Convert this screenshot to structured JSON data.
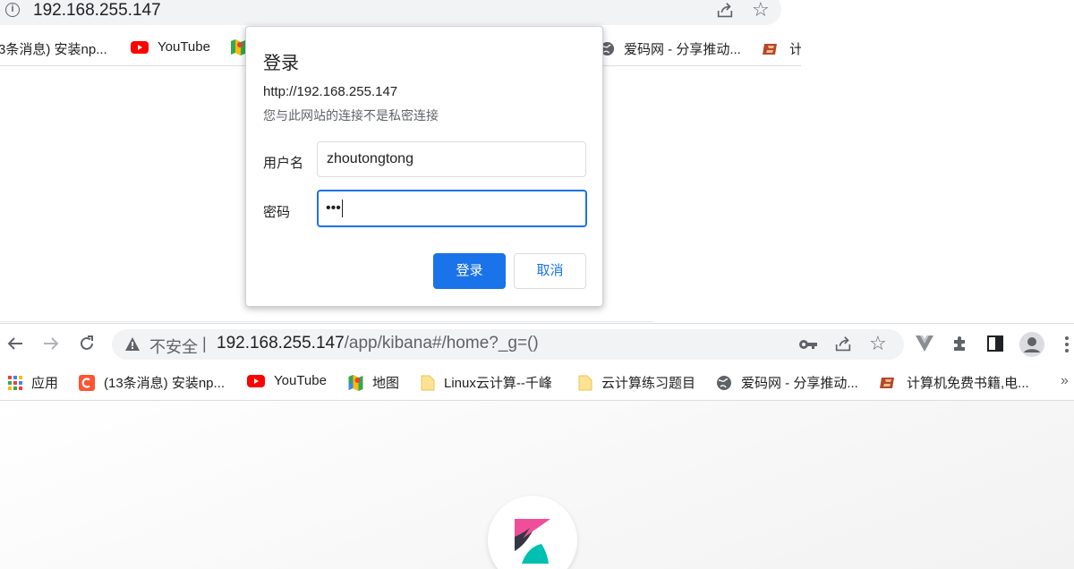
{
  "top_window": {
    "url": "192.168.255.147",
    "bookmarks": [
      {
        "label": "3条消息) 安装np...",
        "icon": "csdn-icon"
      },
      {
        "label": "YouTube",
        "icon": "youtube-icon"
      },
      {
        "label": "爱码网 - 分享推动...",
        "icon": "globe-icon"
      },
      {
        "label": "计",
        "icon": "book-icon"
      }
    ]
  },
  "dialog": {
    "title": "登录",
    "url": "http://192.168.255.147",
    "warning": "您与此网站的连接不是私密连接",
    "username_label": "用户名",
    "username_value": "zhoutongtong",
    "password_label": "密码",
    "password_value": "•••",
    "login_label": "登录",
    "cancel_label": "取消"
  },
  "browser": {
    "not_secure": "不安全",
    "separator": "|",
    "url_host": "192.168.255.147",
    "url_path": "/app/kibana#/home?_g=()",
    "bookmarks": [
      {
        "label": "应用",
        "icon": "apps-grid-icon"
      },
      {
        "label": "(13条消息) 安装np...",
        "icon": "csdn-icon"
      },
      {
        "label": "YouTube",
        "icon": "youtube-icon"
      },
      {
        "label": "地图",
        "icon": "maps-icon"
      },
      {
        "label": "Linux云计算--千峰",
        "icon": "folder-icon"
      },
      {
        "label": "云计算练习题目",
        "icon": "folder-icon"
      },
      {
        "label": "爱码网 - 分享推动...",
        "icon": "globe-icon"
      },
      {
        "label": "计算机免费书籍,电...",
        "icon": "book-icon"
      }
    ],
    "overflow": "»"
  },
  "colors": {
    "accent": "#1a73e8",
    "kibana_pink": "#f04e98",
    "kibana_teal": "#00bfb3",
    "kibana_dark": "#343741"
  }
}
